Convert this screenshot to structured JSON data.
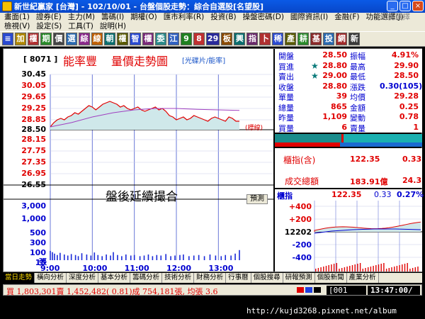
{
  "window": {
    "title": "新世紀贏家 [台灣] - 102/10/01 - 台盤個股走勢：綜合自選股[名望股]",
    "min_label": "_",
    "max_label": "□",
    "close_label": "×"
  },
  "menu": {
    "row1": [
      "畫面(1)",
      "證券(E)",
      "主力(M)",
      "籌碼(I)",
      "期權(O)",
      "匯市利率(R)",
      "投資(B)",
      "操盤密碼(D)",
      "國際資訊(I)",
      "金融(F)",
      "功能選擇(J)"
    ],
    "row2": [
      "檢視(V)",
      "設定(S)",
      "工具(T)",
      "說明(H)"
    ],
    "function_key": "功能選擇"
  },
  "toolbar": {
    "buttons": [
      "≡",
      "加",
      "權",
      "期",
      "價",
      "選",
      "綜",
      "線",
      "朝",
      "權",
      "智",
      "權",
      "委",
      "江",
      "9",
      "8",
      "29",
      "板",
      "興",
      "指",
      "卜",
      "稀",
      "產",
      "耕",
      "基",
      "投",
      "網",
      "新"
    ]
  },
  "chart": {
    "stock_code": "[ 8071 ]",
    "stock_name": "能率豐",
    "title": "量價走勢圖",
    "subtitle": "[光碟片/能率]",
    "reference_tag": "(標線)",
    "after_hours_text": "盤後延續撮合",
    "predict_label": "預測",
    "volume_unit": "張"
  },
  "chart_data": {
    "type": "line",
    "price_axis": {
      "ticks": [
        30.45,
        30.05,
        29.65,
        29.25,
        28.85,
        28.5,
        28.15,
        27.75,
        27.35,
        26.95,
        26.55
      ],
      "ylim": [
        26.55,
        30.45
      ],
      "reference": 28.5
    },
    "volume_axis": {
      "ticks": [
        "3,000",
        "1,000",
        "500",
        "300",
        "100",
        "15"
      ],
      "ylim": [
        0,
        3000
      ]
    },
    "x_ticks": [
      "9:00",
      "10:00",
      "11:00",
      "12:00",
      "13:00"
    ],
    "price_series": {
      "name": "成交價",
      "x_minutes": [
        0,
        5,
        10,
        15,
        20,
        25,
        30,
        35,
        40,
        45,
        50,
        55,
        60,
        65,
        70,
        75,
        80,
        85,
        90,
        95,
        100,
        105,
        110,
        115,
        120,
        125,
        130,
        135,
        140,
        145,
        150,
        155,
        160,
        165,
        170,
        175,
        180,
        185,
        190,
        195,
        200,
        205,
        210,
        215,
        220,
        225,
        230,
        235,
        240,
        245,
        250,
        255,
        260,
        265,
        270
      ],
      "values": [
        28.6,
        28.75,
        28.85,
        28.9,
        28.85,
        28.95,
        29.0,
        29.1,
        29.05,
        29.15,
        29.25,
        29.35,
        29.3,
        29.2,
        29.3,
        29.4,
        29.45,
        29.5,
        29.45,
        29.4,
        29.3,
        29.35,
        29.25,
        29.2,
        29.25,
        29.3,
        29.2,
        29.15,
        29.2,
        29.25,
        29.3,
        29.2,
        29.25,
        29.15,
        29.0,
        28.95,
        28.85,
        28.9,
        28.95,
        28.85,
        28.9,
        29.0,
        28.95,
        28.9,
        28.85,
        28.8,
        28.9,
        28.95,
        28.9,
        28.85,
        28.8,
        28.95,
        28.9,
        28.8,
        28.8
      ]
    },
    "avg_series": {
      "name": "均價",
      "x_minutes": [
        0,
        30,
        60,
        90,
        120,
        150,
        180,
        210,
        240,
        270
      ],
      "values": [
        28.6,
        28.75,
        28.95,
        29.1,
        29.2,
        29.25,
        29.25,
        29.22,
        29.2,
        29.18
      ]
    },
    "volume_series": {
      "name": "成交量",
      "x_minutes": [
        0,
        3,
        6,
        10,
        14,
        20,
        25,
        30,
        36,
        40,
        45,
        52,
        58,
        63,
        68,
        74,
        80,
        86,
        90,
        96,
        102,
        108,
        115,
        120,
        128,
        134,
        140,
        146,
        152,
        158,
        165,
        172,
        178,
        185,
        190,
        198,
        205,
        212,
        220,
        228,
        236,
        244,
        250,
        258,
        264,
        270
      ],
      "values": [
        80,
        60,
        40,
        25,
        50,
        30,
        20,
        35,
        25,
        15,
        45,
        30,
        20,
        55,
        25,
        15,
        30,
        20,
        60,
        25,
        15,
        30,
        20,
        25,
        15,
        20,
        30,
        15,
        25,
        20,
        35,
        15,
        20,
        25,
        30,
        15,
        20,
        25,
        15,
        30,
        20,
        15,
        25,
        20,
        40,
        95
      ]
    }
  },
  "quote": {
    "rows": [
      {
        "l1": "開盤",
        "v1": "28.50",
        "l2": "振幅",
        "v2": "4.91%",
        "c1": "#e00000",
        "c2": "#e00000"
      },
      {
        "l1": "買進",
        "v1": "28.80",
        "l2": "最高",
        "v2": "29.90",
        "c1": "#e00000",
        "c2": "#e00000",
        "star": "★"
      },
      {
        "l1": "賣出",
        "v1": "29.00",
        "l2": "最低",
        "v2": "28.50",
        "c1": "#e00000",
        "c2": "#e00000",
        "star": "★"
      },
      {
        "l1": "收盤",
        "v1": "28.80",
        "l2": "漲跌",
        "v2": "0.30(105)",
        "c1": "#e00000",
        "c2": "#0000d0"
      },
      {
        "l1": "單量",
        "v1": "39",
        "l2": "均價",
        "v2": "29.28",
        "c1": "#e00000",
        "c2": "#e00000"
      },
      {
        "l1": "總量",
        "v1": "865",
        "l2": "金額",
        "v2": "0.25",
        "c1": "#e00000",
        "c2": "#e00000"
      },
      {
        "l1": "昨量",
        "v1": "1,109",
        "l2": "變動",
        "v2": "0.78",
        "c1": "#e00000",
        "c2": "#e00000"
      },
      {
        "l1": "買量",
        "v1": "6",
        "l2": "賣量",
        "v2": "1",
        "c1": "#e00000",
        "c2": "#e00000"
      }
    ]
  },
  "index": {
    "label": "櫃指(含)",
    "value": "122.35",
    "change": "0.33",
    "turnover_label": "成交總額",
    "turnover_value": "183.91億",
    "turnover_change": "24.3"
  },
  "mini_chart": {
    "label": "櫃指",
    "value": "122.35",
    "change": "0.33",
    "pct": "0.27%",
    "ticks": [
      "+400",
      "+200",
      "12202",
      "-200",
      "-400"
    ]
  },
  "tabs": [
    "當日走勢",
    "橫向分析",
    "深度分析",
    "基本分析",
    "籌碼分析",
    "技術分析",
    "財務分析",
    "行事曆",
    "個股搜尋",
    "研報預測",
    "個股新聞",
    "產業分析"
  ],
  "status": {
    "quote_line": "買 1,803,301賣 1,452,482( 0.81)成 754,181張, 均張 3.6",
    "code": "[001",
    "time": "13:47:00/"
  },
  "watermark": "http://kujd3268.pixnet.net/album",
  "colors": {
    "accent_red": "#e00000",
    "accent_blue": "#0000d0",
    "grid_blue": "#6a78d8",
    "area_fill": "#cfe8ea"
  }
}
